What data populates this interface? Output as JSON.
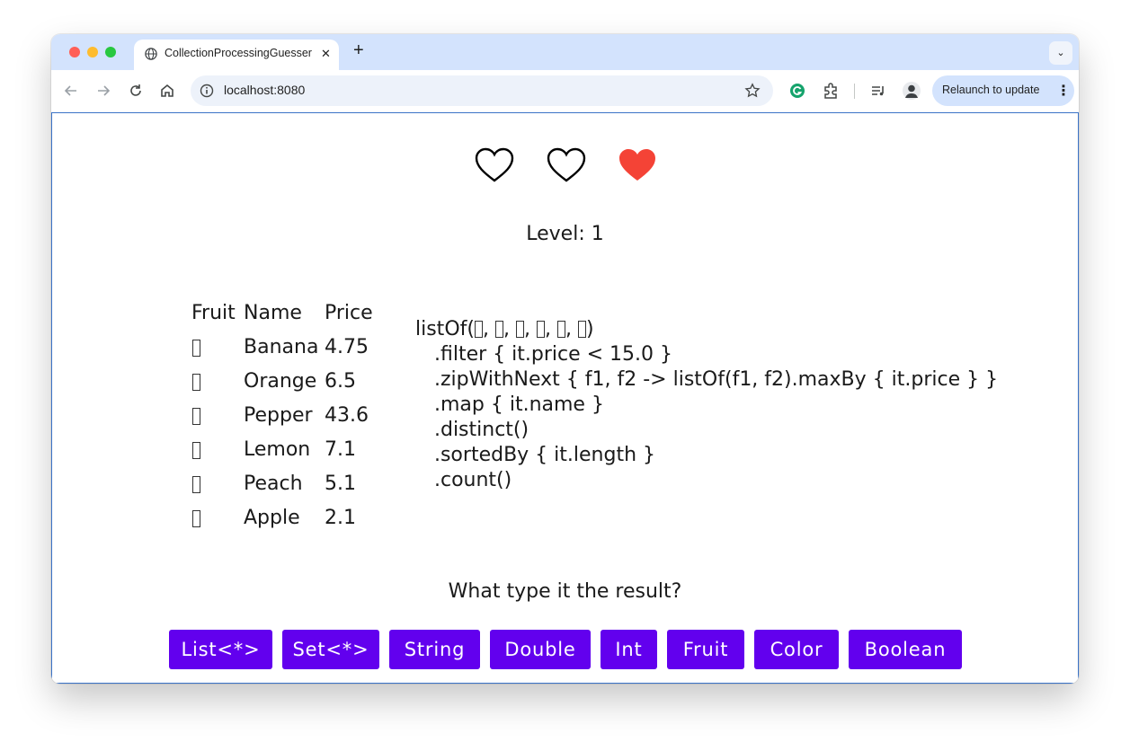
{
  "browser": {
    "tab_title": "CollectionProcessingGuesser",
    "tab_close": "✕",
    "new_tab": "+",
    "tabs_dropdown": "⌄",
    "url": "localhost:8080",
    "relaunch_label": "Relaunch to update",
    "relaunch_menu": "⋮",
    "icons": [
      "back-arrow-icon",
      "forward-arrow-icon",
      "reload-icon",
      "home-icon",
      "site-info-icon",
      "bookmark-star-icon",
      "grammarly-icon",
      "extensions-icon",
      "media-control-icon",
      "profile-avatar-icon"
    ]
  },
  "game": {
    "hearts": [
      {
        "state": "empty"
      },
      {
        "state": "empty"
      },
      {
        "state": "filled"
      }
    ],
    "heart_color": "#f44336",
    "level_text": "Level: 1",
    "table": {
      "headers": [
        "Fruit",
        "Name",
        "Price"
      ],
      "rows": [
        {
          "name": "Banana",
          "price": "4.75"
        },
        {
          "name": "Orange",
          "price": "6.5"
        },
        {
          "name": "Pepper",
          "price": "43.6"
        },
        {
          "name": "Lemon",
          "price": "7.1"
        },
        {
          "name": "Peach",
          "price": "5.1"
        },
        {
          "name": "Apple",
          "price": "2.1"
        }
      ]
    },
    "code_lines": [
      "listOf(",
      "   .filter { it.price < 15.0 }",
      "   .zipWithNext { f1, f2 -> listOf(f1, f2).maxBy { it.price } }",
      "   .map { it.name }",
      "   .distinct()",
      "   .sortedBy { it.length }",
      "   .count()"
    ],
    "code_first_line_suffix": ")",
    "code_first_line_separator": ", ",
    "question": "What type it the result?",
    "answers": [
      "List<*>",
      "Set<*>",
      "String",
      "Double",
      "Int",
      "Fruit",
      "Color",
      "Boolean"
    ],
    "accent_color": "#6200ee"
  }
}
